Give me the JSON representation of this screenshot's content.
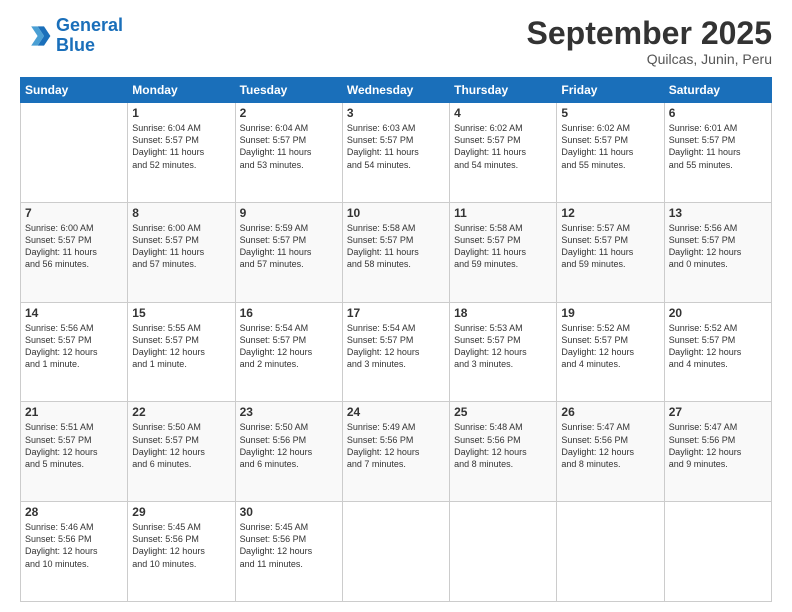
{
  "header": {
    "logo_line1": "General",
    "logo_line2": "Blue",
    "month": "September 2025",
    "location": "Quilcas, Junin, Peru"
  },
  "weekdays": [
    "Sunday",
    "Monday",
    "Tuesday",
    "Wednesday",
    "Thursday",
    "Friday",
    "Saturday"
  ],
  "weeks": [
    [
      {
        "day": "",
        "text": ""
      },
      {
        "day": "1",
        "text": "Sunrise: 6:04 AM\nSunset: 5:57 PM\nDaylight: 11 hours\nand 52 minutes."
      },
      {
        "day": "2",
        "text": "Sunrise: 6:04 AM\nSunset: 5:57 PM\nDaylight: 11 hours\nand 53 minutes."
      },
      {
        "day": "3",
        "text": "Sunrise: 6:03 AM\nSunset: 5:57 PM\nDaylight: 11 hours\nand 54 minutes."
      },
      {
        "day": "4",
        "text": "Sunrise: 6:02 AM\nSunset: 5:57 PM\nDaylight: 11 hours\nand 54 minutes."
      },
      {
        "day": "5",
        "text": "Sunrise: 6:02 AM\nSunset: 5:57 PM\nDaylight: 11 hours\nand 55 minutes."
      },
      {
        "day": "6",
        "text": "Sunrise: 6:01 AM\nSunset: 5:57 PM\nDaylight: 11 hours\nand 55 minutes."
      }
    ],
    [
      {
        "day": "7",
        "text": "Sunrise: 6:00 AM\nSunset: 5:57 PM\nDaylight: 11 hours\nand 56 minutes."
      },
      {
        "day": "8",
        "text": "Sunrise: 6:00 AM\nSunset: 5:57 PM\nDaylight: 11 hours\nand 57 minutes."
      },
      {
        "day": "9",
        "text": "Sunrise: 5:59 AM\nSunset: 5:57 PM\nDaylight: 11 hours\nand 57 minutes."
      },
      {
        "day": "10",
        "text": "Sunrise: 5:58 AM\nSunset: 5:57 PM\nDaylight: 11 hours\nand 58 minutes."
      },
      {
        "day": "11",
        "text": "Sunrise: 5:58 AM\nSunset: 5:57 PM\nDaylight: 11 hours\nand 59 minutes."
      },
      {
        "day": "12",
        "text": "Sunrise: 5:57 AM\nSunset: 5:57 PM\nDaylight: 11 hours\nand 59 minutes."
      },
      {
        "day": "13",
        "text": "Sunrise: 5:56 AM\nSunset: 5:57 PM\nDaylight: 12 hours\nand 0 minutes."
      }
    ],
    [
      {
        "day": "14",
        "text": "Sunrise: 5:56 AM\nSunset: 5:57 PM\nDaylight: 12 hours\nand 1 minute."
      },
      {
        "day": "15",
        "text": "Sunrise: 5:55 AM\nSunset: 5:57 PM\nDaylight: 12 hours\nand 1 minute."
      },
      {
        "day": "16",
        "text": "Sunrise: 5:54 AM\nSunset: 5:57 PM\nDaylight: 12 hours\nand 2 minutes."
      },
      {
        "day": "17",
        "text": "Sunrise: 5:54 AM\nSunset: 5:57 PM\nDaylight: 12 hours\nand 3 minutes."
      },
      {
        "day": "18",
        "text": "Sunrise: 5:53 AM\nSunset: 5:57 PM\nDaylight: 12 hours\nand 3 minutes."
      },
      {
        "day": "19",
        "text": "Sunrise: 5:52 AM\nSunset: 5:57 PM\nDaylight: 12 hours\nand 4 minutes."
      },
      {
        "day": "20",
        "text": "Sunrise: 5:52 AM\nSunset: 5:57 PM\nDaylight: 12 hours\nand 4 minutes."
      }
    ],
    [
      {
        "day": "21",
        "text": "Sunrise: 5:51 AM\nSunset: 5:57 PM\nDaylight: 12 hours\nand 5 minutes."
      },
      {
        "day": "22",
        "text": "Sunrise: 5:50 AM\nSunset: 5:57 PM\nDaylight: 12 hours\nand 6 minutes."
      },
      {
        "day": "23",
        "text": "Sunrise: 5:50 AM\nSunset: 5:56 PM\nDaylight: 12 hours\nand 6 minutes."
      },
      {
        "day": "24",
        "text": "Sunrise: 5:49 AM\nSunset: 5:56 PM\nDaylight: 12 hours\nand 7 minutes."
      },
      {
        "day": "25",
        "text": "Sunrise: 5:48 AM\nSunset: 5:56 PM\nDaylight: 12 hours\nand 8 minutes."
      },
      {
        "day": "26",
        "text": "Sunrise: 5:47 AM\nSunset: 5:56 PM\nDaylight: 12 hours\nand 8 minutes."
      },
      {
        "day": "27",
        "text": "Sunrise: 5:47 AM\nSunset: 5:56 PM\nDaylight: 12 hours\nand 9 minutes."
      }
    ],
    [
      {
        "day": "28",
        "text": "Sunrise: 5:46 AM\nSunset: 5:56 PM\nDaylight: 12 hours\nand 10 minutes."
      },
      {
        "day": "29",
        "text": "Sunrise: 5:45 AM\nSunset: 5:56 PM\nDaylight: 12 hours\nand 10 minutes."
      },
      {
        "day": "30",
        "text": "Sunrise: 5:45 AM\nSunset: 5:56 PM\nDaylight: 12 hours\nand 11 minutes."
      },
      {
        "day": "",
        "text": ""
      },
      {
        "day": "",
        "text": ""
      },
      {
        "day": "",
        "text": ""
      },
      {
        "day": "",
        "text": ""
      }
    ]
  ]
}
